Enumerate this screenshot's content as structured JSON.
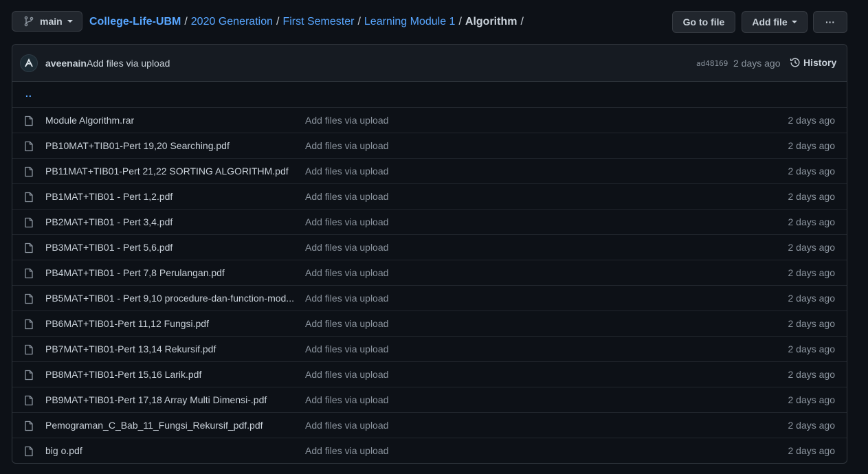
{
  "branch": {
    "label": "main"
  },
  "breadcrumb": {
    "repo": "College-Life-UBM",
    "path": [
      "2020 Generation",
      "First Semester",
      "Learning Module 1"
    ],
    "current": "Algorithm",
    "separator": "/"
  },
  "buttons": {
    "go_to_file": "Go to file",
    "add_file": "Add file",
    "more": "···"
  },
  "commit": {
    "author": "aveenain",
    "message": "Add files via upload",
    "sha": "ad48169",
    "age": "2 days ago",
    "history": "History"
  },
  "parent_link": "..",
  "files": [
    {
      "name": "Module Algorithm.rar",
      "message": "Add files via upload",
      "age": "2 days ago"
    },
    {
      "name": "PB10MAT+TIB01-Pert 19,20 Searching.pdf",
      "message": "Add files via upload",
      "age": "2 days ago"
    },
    {
      "name": "PB11MAT+TIB01-Pert 21,22 SORTING ALGORITHM.pdf",
      "message": "Add files via upload",
      "age": "2 days ago"
    },
    {
      "name": "PB1MAT+TIB01 - Pert 1,2.pdf",
      "message": "Add files via upload",
      "age": "2 days ago"
    },
    {
      "name": "PB2MAT+TIB01 - Pert 3,4.pdf",
      "message": "Add files via upload",
      "age": "2 days ago"
    },
    {
      "name": "PB3MAT+TIB01 - Pert 5,6.pdf",
      "message": "Add files via upload",
      "age": "2 days ago"
    },
    {
      "name": "PB4MAT+TIB01 - Pert 7,8 Perulangan.pdf",
      "message": "Add files via upload",
      "age": "2 days ago"
    },
    {
      "name": "PB5MAT+TIB01 - Pert 9,10 procedure-dan-function-mod...",
      "message": "Add files via upload",
      "age": "2 days ago"
    },
    {
      "name": "PB6MAT+TIB01-Pert 11,12 Fungsi.pdf",
      "message": "Add files via upload",
      "age": "2 days ago"
    },
    {
      "name": "PB7MAT+TIB01-Pert 13,14 Rekursif.pdf",
      "message": "Add files via upload",
      "age": "2 days ago"
    },
    {
      "name": "PB8MAT+TIB01-Pert 15,16 Larik.pdf",
      "message": "Add files via upload",
      "age": "2 days ago"
    },
    {
      "name": "PB9MAT+TIB01-Pert 17,18 Array Multi Dimensi-.pdf",
      "message": "Add files via upload",
      "age": "2 days ago"
    },
    {
      "name": "Pemograman_C_Bab_11_Fungsi_Rekursif_pdf.pdf",
      "message": "Add files via upload",
      "age": "2 days ago"
    },
    {
      "name": "big o.pdf",
      "message": "Add files via upload",
      "age": "2 days ago"
    }
  ],
  "icons": {
    "branch": "git-branch-icon",
    "caret": "caret-down-icon",
    "avatar": "user-avatar",
    "history": "history-clock-icon",
    "file": "file-icon"
  },
  "colors": {
    "background": "#0d1117",
    "link": "#58a6ff",
    "text": "#c9d1d9",
    "muted": "#8b949e",
    "border": "#30363d",
    "header_bg": "#161b22",
    "button_bg": "#21262d"
  }
}
